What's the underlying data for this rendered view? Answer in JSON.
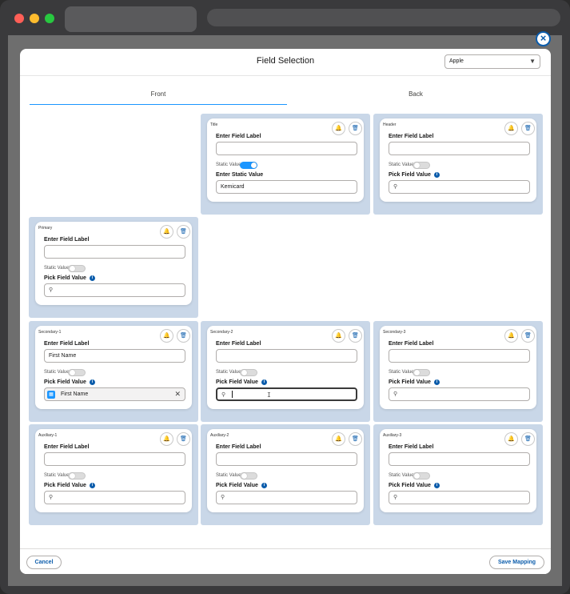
{
  "dialog": {
    "title": "Field Selection",
    "close_symbol": "×",
    "select_value": "Apple",
    "tabs": [
      "Front",
      "Back"
    ],
    "cancel_label": "Cancel",
    "save_label": "Save Mapping"
  },
  "colors": {
    "accent": "#0b5cab",
    "toggle_on": "#1b96ff",
    "cell_bg": "#c9d7e8"
  },
  "labels": {
    "enter_field_label": "Enter Field Label",
    "static_value": "Static Value",
    "enter_static_value": "Enter Static Value",
    "pick_field_value": "Pick Field Value",
    "info_symbol": "i"
  },
  "icons": {
    "bell": "bell-icon",
    "trash": "trash-icon",
    "search": "search-icon",
    "info": "info-icon",
    "close": "close-icon"
  },
  "cards": {
    "title": {
      "slot": "Title",
      "field_label": "",
      "static_on": true,
      "static_value": "Kemicard"
    },
    "header": {
      "slot": "Header",
      "field_label": "",
      "static_on": false
    },
    "primary": {
      "slot": "Primary",
      "field_label": "",
      "static_on": false
    },
    "secondary1": {
      "slot": "Secondary-1",
      "field_label": "First Name",
      "static_on": false,
      "picked_value": "First Name"
    },
    "secondary2": {
      "slot": "Secondary-2",
      "field_label": "",
      "static_on": false,
      "search_focused": true
    },
    "secondary3": {
      "slot": "Secondary-3",
      "field_label": "",
      "static_on": false
    },
    "auxiliary1": {
      "slot": "Auxiliary-1",
      "field_label": "",
      "static_on": false
    },
    "auxiliary2": {
      "slot": "Auxiliary-2",
      "field_label": "",
      "static_on": false
    },
    "auxiliary3": {
      "slot": "Auxiliary-3",
      "field_label": "",
      "static_on": false
    }
  }
}
